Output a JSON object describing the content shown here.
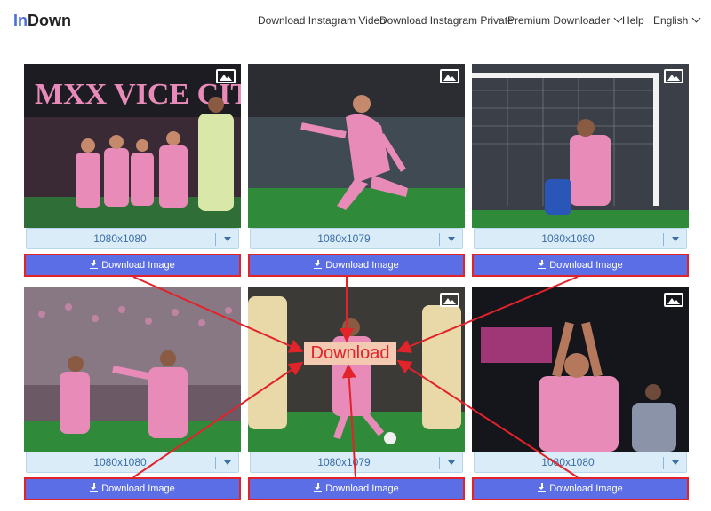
{
  "brand": {
    "in": "In",
    "down": "Down"
  },
  "nav": [
    {
      "label": "Download Instagram Video",
      "dropdown": false
    },
    {
      "label": "Download Instagram Private",
      "dropdown": false
    },
    {
      "label": "Premium Downloader",
      "dropdown": true
    },
    {
      "label": "Help",
      "dropdown": false
    },
    {
      "label": "English",
      "dropdown": true
    }
  ],
  "cards": [
    {
      "resolution": "1080x1080",
      "button": "Download Image",
      "theme": "vice-city-celebration"
    },
    {
      "resolution": "1080x1079",
      "button": "Download Image",
      "theme": "kick-pink-jersey"
    },
    {
      "resolution": "1080x1080",
      "button": "Download Image",
      "theme": "goal-net-celebration"
    },
    {
      "resolution": "1080x1080",
      "button": "Download Image",
      "theme": "crowd-run-celebration"
    },
    {
      "resolution": "1080x1079",
      "button": "Download Image",
      "theme": "ball-control-defenders"
    },
    {
      "resolution": "1080x1080",
      "button": "Download Image",
      "theme": "clapping-night"
    }
  ],
  "overlay": {
    "label": "Download"
  },
  "colors": {
    "button": "#5b6ee6",
    "highlight": "#e2232a",
    "select_bg": "#d9ecf8",
    "pitch": "#2f8a3a",
    "pink": "#e88bb9"
  }
}
